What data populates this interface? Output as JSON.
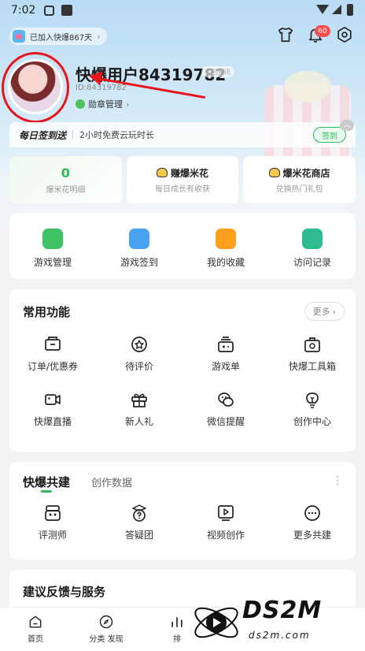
{
  "status_bar": {
    "time": "7:02"
  },
  "header": {
    "joined_label": "已加入快爆867天",
    "notification_count": "60"
  },
  "profile": {
    "username": "快爆用户84319782",
    "user_id": "ID:84319782",
    "tag": "礼包资讯",
    "medal_label": "勋章管理"
  },
  "daily": {
    "title": "每日签到送",
    "desc": "2小时免费云玩时长",
    "sign_label": "签到"
  },
  "popcorn": {
    "count": "0",
    "detail_label": "爆米花明细",
    "earn_title": "赚爆米花",
    "earn_sub": "每日成长有收获",
    "shop_title": "爆米花商店",
    "shop_sub": "兑换热门礼包"
  },
  "quick_items": [
    {
      "label": "游戏管理",
      "icon": "gamepad-icon",
      "color": "#3fc266"
    },
    {
      "label": "游戏签到",
      "icon": "calendar-check-icon",
      "color": "#4aa3f0"
    },
    {
      "label": "我的收藏",
      "icon": "star-badge-icon",
      "color": "#ff9f1a"
    },
    {
      "label": "访问记录",
      "icon": "bookmark-icon",
      "color": "#2dbb90"
    }
  ],
  "common": {
    "title": "常用功能",
    "more_label": "更多",
    "items": [
      {
        "label": "订单/优惠券",
        "icon": "coupon-icon"
      },
      {
        "label": "待评价",
        "icon": "star-circle-icon"
      },
      {
        "label": "游戏单",
        "icon": "game-list-icon"
      },
      {
        "label": "快爆工具箱",
        "icon": "toolbox-icon"
      },
      {
        "label": "快爆直播",
        "icon": "video-camera-icon"
      },
      {
        "label": "新人礼",
        "icon": "gift-icon"
      },
      {
        "label": "微信提醒",
        "icon": "wechat-icon"
      },
      {
        "label": "创作中心",
        "icon": "lightbulb-icon"
      }
    ]
  },
  "build": {
    "tab_active": "快爆共建",
    "tab_inactive": "创作数据",
    "items": [
      {
        "label": "评测师",
        "icon": "reviewer-icon"
      },
      {
        "label": "答疑团",
        "icon": "question-icon"
      },
      {
        "label": "视频创作",
        "icon": "play-square-icon"
      },
      {
        "label": "更多共建",
        "icon": "more-circle-icon"
      }
    ]
  },
  "feedback": {
    "title": "建议反馈与服务"
  },
  "bottom_nav": [
    {
      "label": "首页",
      "icon": "home-icon"
    },
    {
      "label": "分类 发现",
      "icon": "compass-icon"
    },
    {
      "label": "排",
      "icon": "rank-icon"
    }
  ],
  "watermark": {
    "text": "DS2M",
    "sub": "ds2m.com"
  },
  "colors": {
    "accent": "#2dbb55",
    "annotation_red": "#e8141a"
  }
}
